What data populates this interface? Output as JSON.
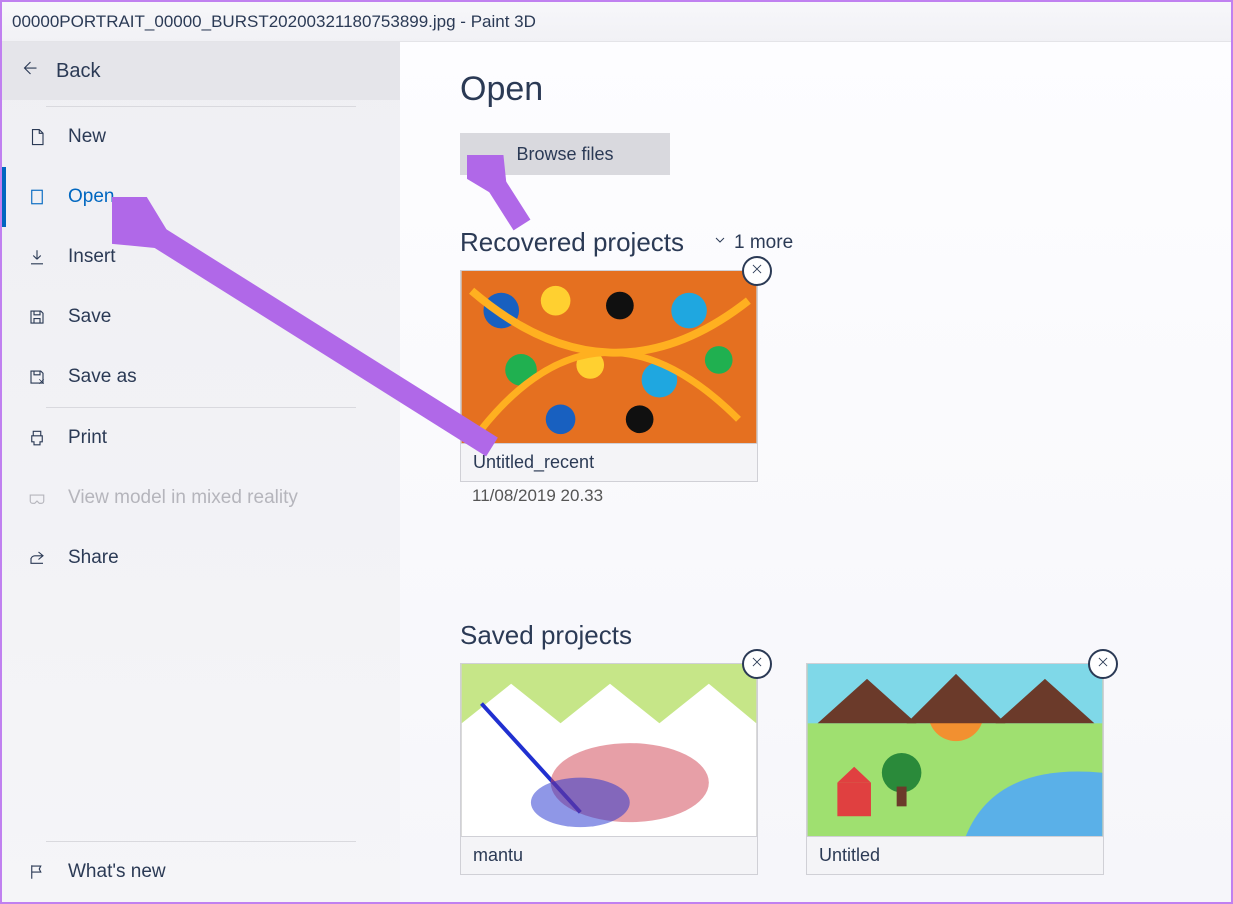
{
  "title": "00000PORTRAIT_00000_BURST20200321180753899.jpg - Paint 3D",
  "back": "Back",
  "menu": {
    "new": "New",
    "open": "Open",
    "insert": "Insert",
    "save": "Save",
    "saveas": "Save as",
    "print": "Print",
    "viewmr": "View model in mixed reality",
    "share": "Share",
    "whatsnew": "What's new"
  },
  "main": {
    "heading": "Open",
    "browse": "Browse files",
    "recovered_h": "Recovered projects",
    "more": "1 more",
    "saved_h": "Saved projects"
  },
  "recovered": [
    {
      "name": "Untitled_recent",
      "ts": "11/08/2019 20.33"
    }
  ],
  "saved": [
    {
      "name": "mantu"
    },
    {
      "name": "Untitled"
    }
  ]
}
